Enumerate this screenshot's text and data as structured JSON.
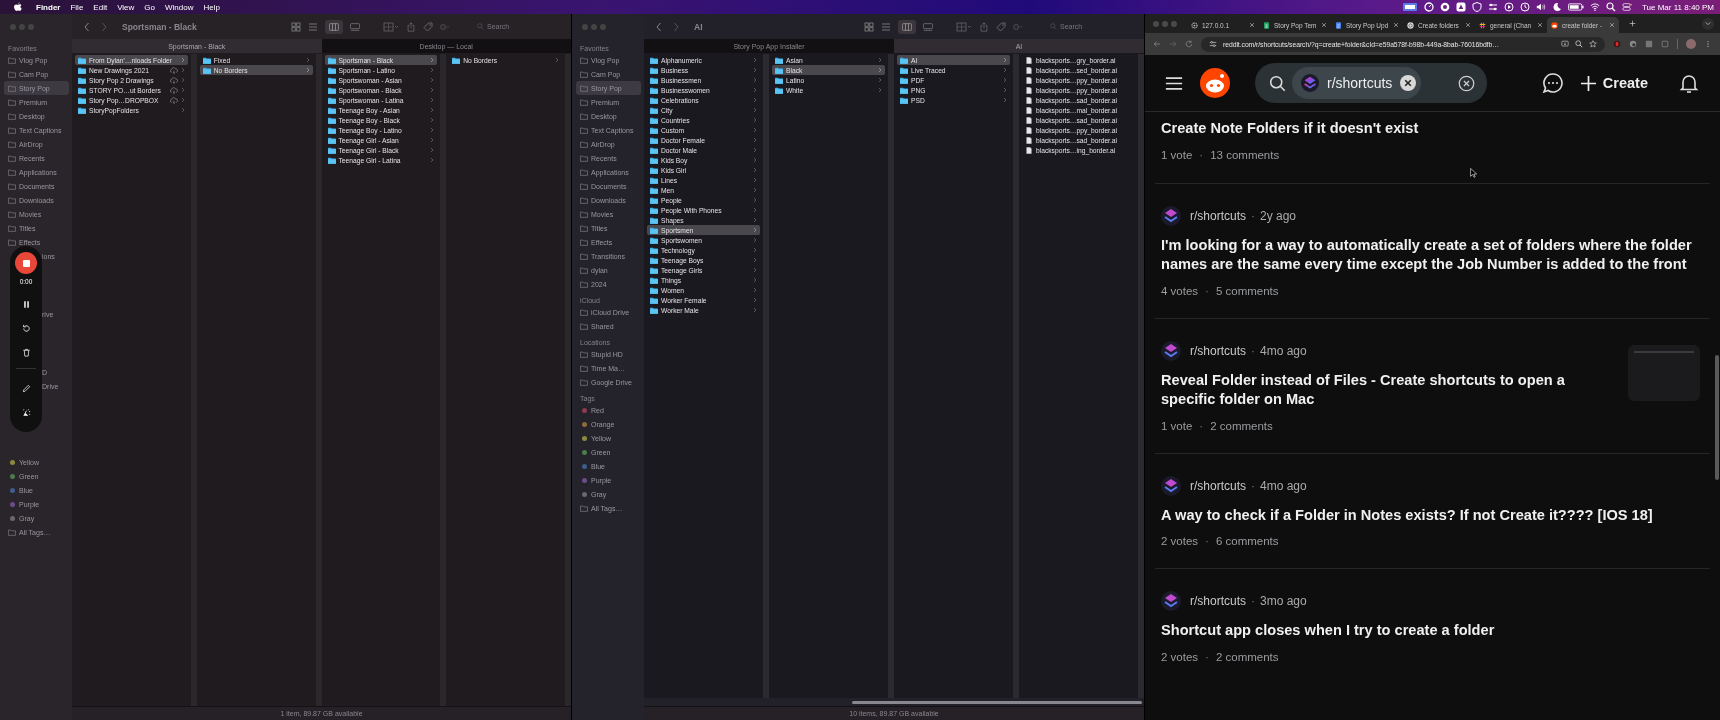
{
  "menu_bar": {
    "app": "Finder",
    "menus": [
      "File",
      "Edit",
      "View",
      "Go",
      "Window",
      "Help"
    ],
    "clock": "Tue Mar 11  8:40 PM"
  },
  "recorder": {
    "timer": "0:00"
  },
  "finder_windows": [
    {
      "title": "Sportsman - Black",
      "search": {
        "placeholder": "Search"
      },
      "sidebar": [
        {
          "heading": "Favorites",
          "items": [
            {
              "label": "Vlog Pop",
              "kind": "place",
              "selected": false
            },
            {
              "label": "Cam Pop",
              "kind": "place",
              "selected": false
            },
            {
              "label": "Story Pop",
              "kind": "place",
              "selected": true
            },
            {
              "label": "Premium",
              "kind": "place",
              "selected": false
            },
            {
              "label": "Desktop",
              "kind": "place",
              "selected": false
            },
            {
              "label": "Text Captions",
              "kind": "place",
              "selected": false
            },
            {
              "label": "AirDrop",
              "kind": "place",
              "selected": false
            },
            {
              "label": "Recents",
              "kind": "place",
              "selected": false
            },
            {
              "label": "Applications",
              "kind": "place",
              "selected": false
            },
            {
              "label": "Documents",
              "kind": "place",
              "selected": false
            },
            {
              "label": "Downloads",
              "kind": "place",
              "selected": false
            },
            {
              "label": "Movies",
              "kind": "place",
              "selected": false
            },
            {
              "label": "Titles",
              "kind": "place",
              "selected": false
            },
            {
              "label": "Effects",
              "kind": "place",
              "selected": false
            },
            {
              "label": "ions",
              "kind": "cut",
              "selected": false
            }
          ]
        },
        {
          "items": [
            {
              "label": "rive",
              "kind": "cut",
              "selected": false
            }
          ]
        },
        {
          "items": [
            {
              "label": "D",
              "kind": "cut",
              "selected": false
            },
            {
              "label": "Drive",
              "kind": "cut",
              "selected": false
            }
          ]
        },
        {
          "items": [
            {
              "label": "Yellow",
              "kind": "tag",
              "selected": false,
              "color": "#8c8a3c"
            },
            {
              "label": "Green",
              "kind": "tag",
              "selected": false,
              "color": "#4c7c4e"
            },
            {
              "label": "Blue",
              "kind": "tag",
              "selected": false,
              "color": "#3e5c8c"
            },
            {
              "label": "Purple",
              "kind": "tag",
              "selected": false,
              "color": "#6c4c8c"
            },
            {
              "label": "Gray",
              "kind": "tag",
              "selected": false,
              "color": "#6a686c"
            },
            {
              "label": "All Tags…",
              "kind": "place",
              "selected": false
            }
          ]
        }
      ],
      "path_tabs": [
        {
          "label": "Sportsman - Black",
          "selected": true
        },
        {
          "label": "Desktop — Local",
          "selected": false
        }
      ],
      "columns": [
        {
          "items": [
            {
              "name": "From Dylan'…nloads Folder",
              "kind": "folder",
              "selected": true,
              "cloud": false
            },
            {
              "name": "New Drawings 2021",
              "kind": "folder",
              "selected": false,
              "cloud": true
            },
            {
              "name": "Story Pop 2 Drawings",
              "kind": "folder",
              "selected": false,
              "cloud": true
            },
            {
              "name": "STORY PO…ut Borders",
              "kind": "folder",
              "selected": false,
              "cloud": true
            },
            {
              "name": "Story Pop…DROPBOX",
              "kind": "folder",
              "selected": false,
              "cloud": true
            },
            {
              "name": "StoryPopFolders",
              "kind": "folder",
              "selected": false,
              "cloud": false
            }
          ]
        },
        {
          "items": [
            {
              "name": "Fixed",
              "kind": "folder",
              "selected": false
            },
            {
              "name": "No Borders",
              "kind": "folder",
              "selected": true
            }
          ]
        },
        {
          "items": [
            {
              "name": "Sportsman - Black",
              "kind": "folder",
              "selected": true
            },
            {
              "name": "Sportsman - Latino",
              "kind": "folder",
              "selected": false
            },
            {
              "name": "Sportswoman - Asian",
              "kind": "folder",
              "selected": false
            },
            {
              "name": "Sportswoman - Black",
              "kind": "folder",
              "selected": false
            },
            {
              "name": "Sportswoman - Latina",
              "kind": "folder",
              "selected": false
            },
            {
              "name": "Teenage Boy - Asian",
              "kind": "folder",
              "selected": false
            },
            {
              "name": "Teenage Boy - Black",
              "kind": "folder",
              "selected": false
            },
            {
              "name": "Teenage Boy - Latino",
              "kind": "folder",
              "selected": false
            },
            {
              "name": "Teenage Girl - Asian",
              "kind": "folder",
              "selected": false
            },
            {
              "name": "Teenage Girl - Black",
              "kind": "folder",
              "selected": false
            },
            {
              "name": "Teenage Girl - Latina",
              "kind": "folder",
              "selected": false
            }
          ]
        },
        {
          "items": [
            {
              "name": "No Borders",
              "kind": "folder",
              "selected": false
            }
          ]
        }
      ],
      "status": "1 item, 89.87 GB available"
    },
    {
      "title": "AI",
      "search": {
        "placeholder": "Search"
      },
      "sidebar": [
        {
          "heading": "Favorites",
          "items": [
            {
              "label": "Vlog Pop",
              "kind": "place",
              "selected": false
            },
            {
              "label": "Cam Pop",
              "kind": "place",
              "selected": false
            },
            {
              "label": "Story Pop",
              "kind": "place",
              "selected": true
            },
            {
              "label": "Premium",
              "kind": "place",
              "selected": false
            },
            {
              "label": "Desktop",
              "kind": "place",
              "selected": false
            },
            {
              "label": "Text Captions",
              "kind": "place",
              "selected": false
            },
            {
              "label": "AirDrop",
              "kind": "place",
              "selected": false
            },
            {
              "label": "Recents",
              "kind": "place",
              "selected": false
            },
            {
              "label": "Applications",
              "kind": "place",
              "selected": false
            },
            {
              "label": "Documents",
              "kind": "place",
              "selected": false
            },
            {
              "label": "Downloads",
              "kind": "place",
              "selected": false
            },
            {
              "label": "Movies",
              "kind": "place",
              "selected": false
            },
            {
              "label": "Titles",
              "kind": "place",
              "selected": false
            },
            {
              "label": "Effects",
              "kind": "place",
              "selected": false
            },
            {
              "label": "Transitions",
              "kind": "place",
              "selected": false
            },
            {
              "label": "dylan",
              "kind": "place",
              "selected": false
            },
            {
              "label": "2024",
              "kind": "place",
              "selected": false
            }
          ]
        },
        {
          "heading": "iCloud",
          "items": [
            {
              "label": "iCloud Drive",
              "kind": "place",
              "selected": false
            },
            {
              "label": "Shared",
              "kind": "place",
              "selected": false
            }
          ]
        },
        {
          "heading": "Locations",
          "items": [
            {
              "label": "Stupid HD",
              "kind": "place",
              "selected": false
            },
            {
              "label": "Time Ma…",
              "kind": "place",
              "selected": false
            },
            {
              "label": "Google Drive",
              "kind": "place",
              "selected": false
            }
          ]
        },
        {
          "heading": "Tags",
          "items": [
            {
              "label": "Red",
              "kind": "tag",
              "selected": false,
              "color": "#8c3c4a"
            },
            {
              "label": "Orange",
              "kind": "tag",
              "selected": false,
              "color": "#8c6a3c"
            },
            {
              "label": "Yellow",
              "kind": "tag",
              "selected": false,
              "color": "#8c8a3c"
            },
            {
              "label": "Green",
              "kind": "tag",
              "selected": false,
              "color": "#4c7c4e"
            },
            {
              "label": "Blue",
              "kind": "tag",
              "selected": false,
              "color": "#3e5c8c"
            },
            {
              "label": "Purple",
              "kind": "tag",
              "selected": false,
              "color": "#6c4c8c"
            },
            {
              "label": "Gray",
              "kind": "tag",
              "selected": false,
              "color": "#6a686c"
            },
            {
              "label": "All Tags…",
              "kind": "place",
              "selected": false
            }
          ]
        }
      ],
      "path_tabs": [
        {
          "label": "Story Pop App Installer",
          "selected": false
        },
        {
          "label": "AI",
          "selected": true
        }
      ],
      "columns": [
        {
          "items": [
            {
              "name": "Alphanumeric",
              "kind": "folder",
              "selected": false
            },
            {
              "name": "Business",
              "kind": "folder",
              "selected": false
            },
            {
              "name": "Businessmen",
              "kind": "folder",
              "selected": false
            },
            {
              "name": "Businesswomen",
              "kind": "folder",
              "selected": false
            },
            {
              "name": "Celebrations",
              "kind": "folder",
              "selected": false
            },
            {
              "name": "City",
              "kind": "folder",
              "selected": false
            },
            {
              "name": "Countries",
              "kind": "folder",
              "selected": false
            },
            {
              "name": "Custom",
              "kind": "folder",
              "selected": false
            },
            {
              "name": "Doctor Female",
              "kind": "folder",
              "selected": false
            },
            {
              "name": "Doctor Male",
              "kind": "folder",
              "selected": false
            },
            {
              "name": "Kids Boy",
              "kind": "folder",
              "selected": false
            },
            {
              "name": "Kids Girl",
              "kind": "folder",
              "selected": false
            },
            {
              "name": "Lines",
              "kind": "folder",
              "selected": false
            },
            {
              "name": "Men",
              "kind": "folder",
              "selected": false
            },
            {
              "name": "People",
              "kind": "folder",
              "selected": false
            },
            {
              "name": "People With Phones",
              "kind": "folder",
              "selected": false
            },
            {
              "name": "Shapes",
              "kind": "folder",
              "selected": false
            },
            {
              "name": "Sportsmen",
              "kind": "folder",
              "selected": true
            },
            {
              "name": "Sportswomen",
              "kind": "folder",
              "selected": false
            },
            {
              "name": "Technology",
              "kind": "folder",
              "selected": false
            },
            {
              "name": "Teenage Boys",
              "kind": "folder",
              "selected": false
            },
            {
              "name": "Teenage Girls",
              "kind": "folder",
              "selected": false
            },
            {
              "name": "Things",
              "kind": "folder",
              "selected": false
            },
            {
              "name": "Women",
              "kind": "folder",
              "selected": false
            },
            {
              "name": "Worker Female",
              "kind": "folder",
              "selected": false
            },
            {
              "name": "Worker Male",
              "kind": "folder",
              "selected": false
            }
          ]
        },
        {
          "items": [
            {
              "name": "Asian",
              "kind": "folder",
              "selected": false
            },
            {
              "name": "Black",
              "kind": "folder",
              "selected": true
            },
            {
              "name": "Latino",
              "kind": "folder",
              "selected": false
            },
            {
              "name": "White",
              "kind": "folder",
              "selected": false
            }
          ]
        },
        {
          "items": [
            {
              "name": "AI",
              "kind": "folder",
              "selected": true
            },
            {
              "name": "Live Traced",
              "kind": "folder",
              "selected": false
            },
            {
              "name": "PDF",
              "kind": "folder",
              "selected": false
            },
            {
              "name": "PNG",
              "kind": "folder",
              "selected": false
            },
            {
              "name": "PSD",
              "kind": "folder",
              "selected": false
            }
          ]
        },
        {
          "items": [
            {
              "name": "blacksports…gry_border.ai",
              "kind": "file",
              "selected": false
            },
            {
              "name": "blacksports…sed_border.ai",
              "kind": "file",
              "selected": false
            },
            {
              "name": "blacksports…ppy_border.ai",
              "kind": "file",
              "selected": false
            },
            {
              "name": "blacksports…ppy_border.ai",
              "kind": "file",
              "selected": false
            },
            {
              "name": "blacksports…sad_border.ai",
              "kind": "file",
              "selected": false
            },
            {
              "name": "blacksports…mal_border.ai",
              "kind": "file",
              "selected": false
            },
            {
              "name": "blacksports…sad_border.ai",
              "kind": "file",
              "selected": false
            },
            {
              "name": "blacksports…ppy_border.ai",
              "kind": "file",
              "selected": false
            },
            {
              "name": "blacksports…sad_border.ai",
              "kind": "file",
              "selected": false
            },
            {
              "name": "blacksports…ing_border.ai",
              "kind": "file",
              "selected": false
            }
          ]
        }
      ],
      "status": "10 items, 89.87 GB available"
    }
  ],
  "browser": {
    "tabs": [
      {
        "title": "127.0.0.1",
        "kind": "gear",
        "selected": false
      },
      {
        "title": "Story Pop Tem",
        "kind": "sheet",
        "selected": false
      },
      {
        "title": "Story Pop Upd",
        "kind": "doc",
        "selected": false
      },
      {
        "title": "Create folders",
        "kind": "knot",
        "selected": false
      },
      {
        "title": "general (Chan",
        "kind": "hash",
        "selected": false
      },
      {
        "title": "create folder -",
        "kind": "alien",
        "selected": true
      }
    ],
    "url": "reddit.com/r/shortcuts/search/?q=create+folder&cId=e59a578f-b98b-449a-8bab-76016bdfb…",
    "search_chip": "r/shortcuts",
    "create_label": "Create",
    "posts": [
      {
        "title": "Create Note Folders if it doesn't exist",
        "votes": "1 vote",
        "stats_separator": "·",
        "comments": "13 comments",
        "thumbnail": false
      },
      {
        "community": "r/shortcuts",
        "community_separator": "·",
        "age": "2y ago",
        "title": "I'm looking for a way to automatically create a set of folders where the folder names are the same every time except the Job Number is added to the front",
        "votes": "4 votes",
        "stats_separator": "·",
        "comments": "5 comments",
        "thumbnail": false
      },
      {
        "community": "r/shortcuts",
        "community_separator": "·",
        "age": "4mo ago",
        "title": "Reveal Folder instead of Files - Create shortcuts to open a specific folder on Mac",
        "votes": "1 vote",
        "stats_separator": "·",
        "comments": "2 comments",
        "thumbnail": true
      },
      {
        "community": "r/shortcuts",
        "community_separator": "·",
        "age": "4mo ago",
        "title": "A way to check if a Folder in Notes exists? If not Create it???? [IOS 18]",
        "votes": "2 votes",
        "stats_separator": "·",
        "comments": "6 comments",
        "thumbnail": false
      },
      {
        "community": "r/shortcuts",
        "community_separator": "·",
        "age": "3mo ago",
        "title": "Shortcut app closes when I try to create a folder",
        "votes": "2 votes",
        "stats_separator": "·",
        "comments": "2 comments",
        "thumbnail": false
      }
    ]
  }
}
